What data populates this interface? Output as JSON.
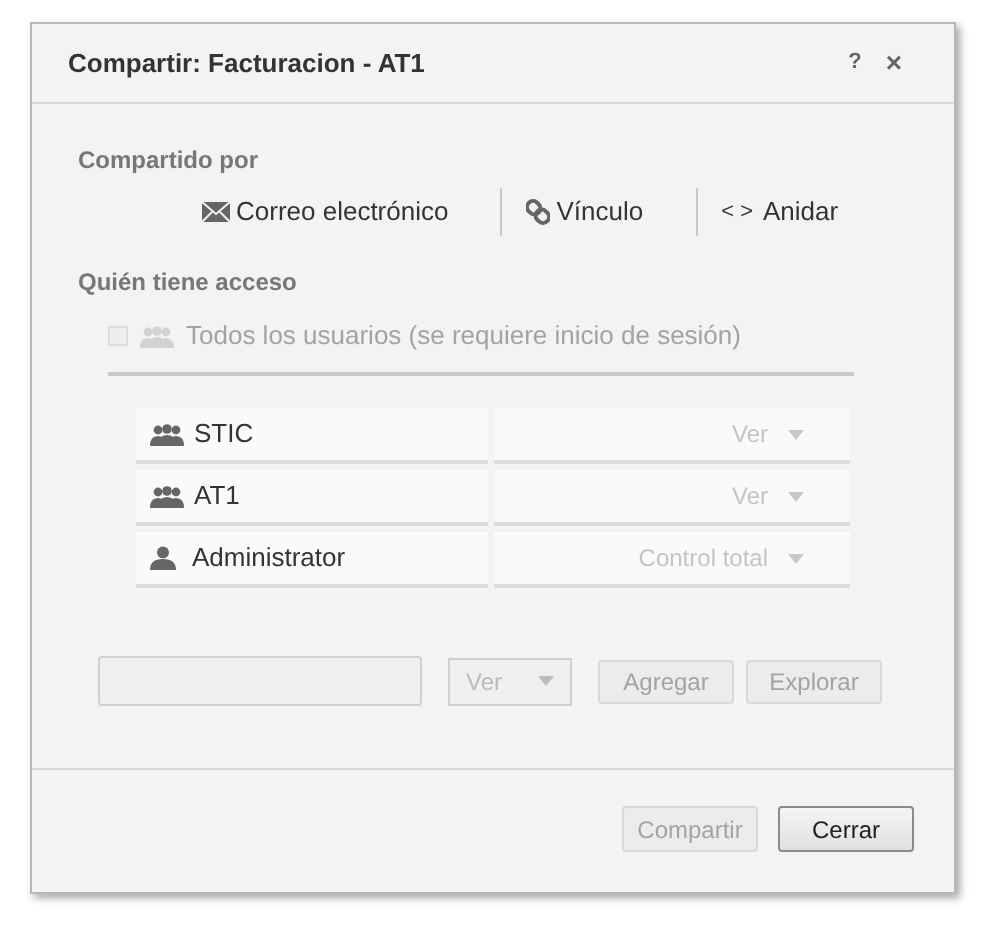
{
  "dialog": {
    "title": "Compartir: Facturacion - AT1",
    "help": "?",
    "close": "×"
  },
  "shared_by": {
    "heading": "Compartido por",
    "options": [
      {
        "kind": "email",
        "label": "Correo electrónico"
      },
      {
        "kind": "link",
        "label": "Vínculo"
      },
      {
        "kind": "embed",
        "icon_text": "< >",
        "label": "Anidar"
      }
    ]
  },
  "access": {
    "heading": "Quién tiene acceso",
    "everyone": {
      "label": "Todos los usuarios (se requiere inicio de sesión)",
      "checked": false,
      "disabled": true
    },
    "entries": [
      {
        "kind": "group",
        "name": "STIC",
        "permission": "Ver"
      },
      {
        "kind": "group",
        "name": "AT1",
        "permission": "Ver"
      },
      {
        "kind": "user",
        "name": "Administrator",
        "permission": "Control total"
      }
    ]
  },
  "add_row": {
    "permission": "Ver",
    "buttons": [
      {
        "label": "Agregar",
        "disabled": true
      },
      {
        "label": "Explorar",
        "disabled": true
      }
    ]
  },
  "footer": {
    "buttons": [
      {
        "label": "Compartir",
        "disabled": true
      },
      {
        "label": "Cerrar",
        "disabled": false
      }
    ]
  }
}
